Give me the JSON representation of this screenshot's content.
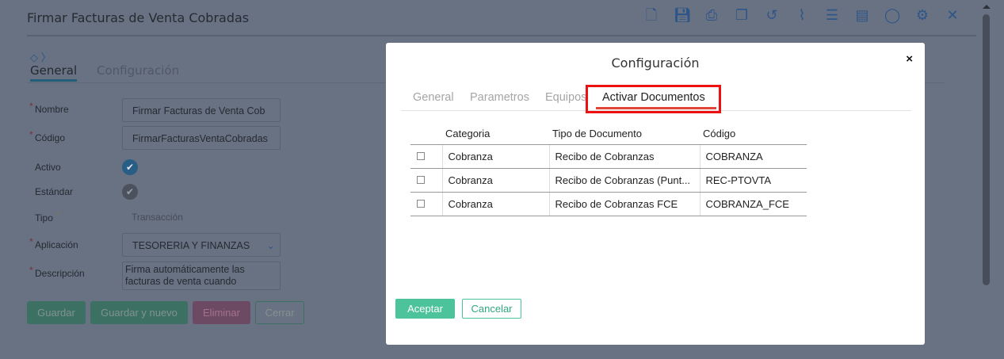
{
  "header": {
    "title": "Firmar Facturas de Venta Cobradas",
    "toolbar": [
      "new-document",
      "save",
      "print",
      "copy",
      "history",
      "attach",
      "checklist",
      "report",
      "comment",
      "settings",
      "close"
    ]
  },
  "tabs": [
    "General",
    "Configuración"
  ],
  "form": {
    "nombre_label": "Nombre",
    "nombre_value": "Firmar Facturas de Venta Cob",
    "codigo_label": "Código",
    "codigo_value": "FirmarFacturasVentaCobradas",
    "activo_label": "Activo",
    "estandar_label": "Estándar",
    "tipo_label": "Tipo",
    "tipo_value": "Transacción",
    "help": "?",
    "aplicacion_label": "Aplicación",
    "aplicacion_value": "TESORERIA Y FINANZAS",
    "descripcion_label": "Descripción",
    "descripcion_value": "Firma automáticamente las facturas de venta cuando"
  },
  "buttons": {
    "guardar": "Guardar",
    "guardar_nuevo": "Guardar y nuevo",
    "eliminar": "Eliminar",
    "cerrar": "Cerrar"
  },
  "modal": {
    "title": "Configuración",
    "close": "×",
    "tabs": [
      "General",
      "Parametros",
      "Equipos",
      "Activar Documentos"
    ],
    "columns": [
      "Categoria",
      "Tipo de Documento",
      "Código"
    ],
    "rows": [
      {
        "categoria": "Cobranza",
        "tipo": "Recibo de Cobranzas",
        "codigo": "COBRANZA"
      },
      {
        "categoria": "Cobranza",
        "tipo": "Recibo de Cobranzas (Punt...",
        "codigo": "REC-PTOVTA"
      },
      {
        "categoria": "Cobranza",
        "tipo": "Recibo de Cobranzas FCE",
        "codigo": "COBRANZA_FCE"
      }
    ],
    "accept": "Aceptar",
    "cancel": "Cancelar"
  }
}
